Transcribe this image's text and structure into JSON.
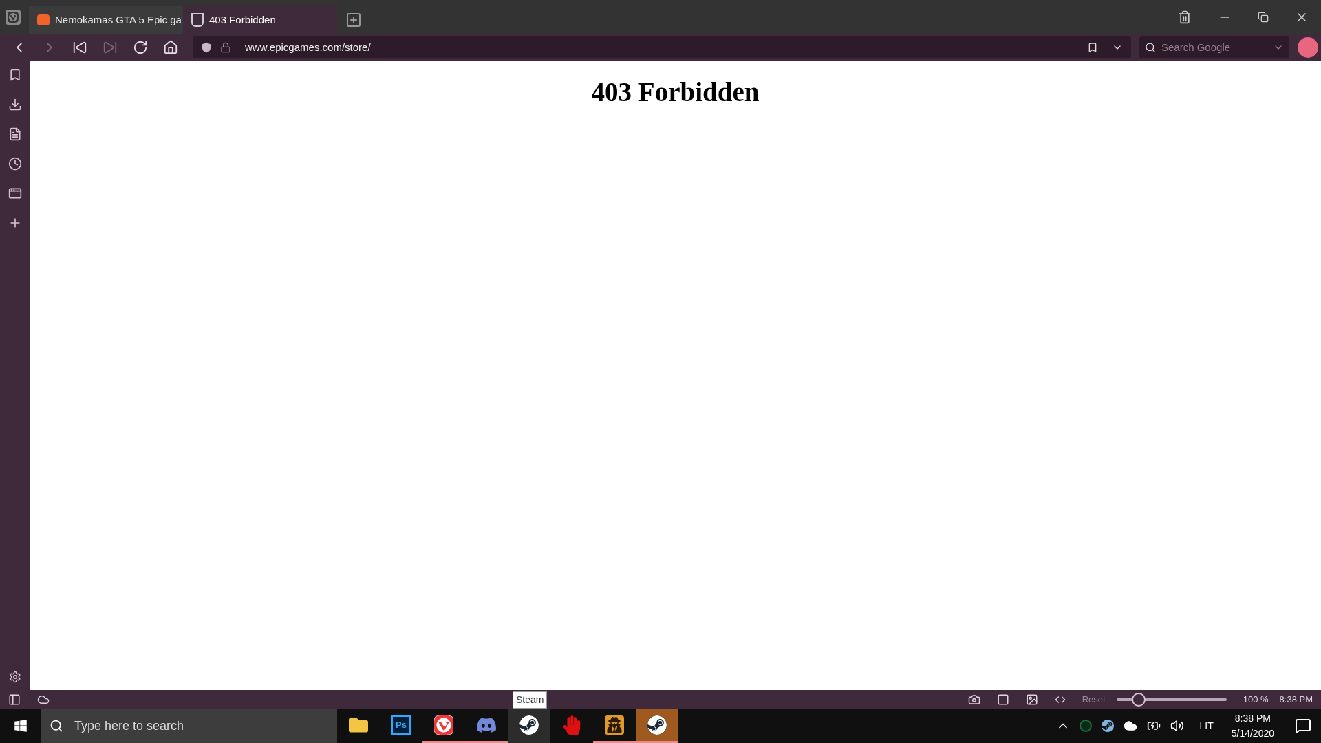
{
  "browser": {
    "tabs": [
      {
        "title": "Nemokamas GTA 5 Epic ga",
        "kind": "orange",
        "selected": false
      },
      {
        "title": "403 Forbidden",
        "kind": "epic",
        "selected": true
      }
    ],
    "nav_buttons": [
      {
        "kind": "back",
        "disabled": false
      },
      {
        "kind": "forward",
        "disabled": true
      },
      {
        "kind": "rewind",
        "disabled": false
      },
      {
        "kind": "fastforward",
        "disabled": true
      },
      {
        "kind": "reload",
        "disabled": false
      },
      {
        "kind": "home",
        "disabled": false
      }
    ],
    "address": "www.epicgames.com/store/",
    "search": {
      "placeholder": "Search Google"
    },
    "sidebar": [
      {
        "kind": "bookmarks"
      },
      {
        "kind": "downloads"
      },
      {
        "kind": "notes"
      },
      {
        "kind": "history"
      },
      {
        "kind": "window"
      },
      {
        "kind": "add"
      }
    ],
    "page": {
      "heading": "403 Forbidden"
    },
    "status_bar": {
      "reset": "Reset",
      "zoom": {
        "level": 0.2
      },
      "zoom_reading": "100 %",
      "clock": "8:38 PM"
    },
    "tooltip": "Steam"
  },
  "taskbar": {
    "search": {
      "placeholder": "Type here to search"
    },
    "apps": [
      {
        "kind": "explorer",
        "running": false,
        "selected": false,
        "hovered": false
      },
      {
        "kind": "photoshop",
        "label": "Ps",
        "running": false,
        "selected": false,
        "hovered": false
      },
      {
        "kind": "vivaldi",
        "running": true,
        "selected": false,
        "hovered": false
      },
      {
        "kind": "discord",
        "running": true,
        "selected": false,
        "hovered": false
      },
      {
        "kind": "steam",
        "running": false,
        "selected": false,
        "hovered": true
      },
      {
        "kind": "bloody",
        "running": false,
        "selected": false,
        "hovered": false
      },
      {
        "kind": "csgo",
        "running": true,
        "selected": false,
        "hovered": false
      },
      {
        "kind": "steam",
        "running": true,
        "selected": true,
        "hovered": false
      }
    ],
    "language": "LIT",
    "time": "8:38 PM",
    "date": "5/14/2020"
  }
}
